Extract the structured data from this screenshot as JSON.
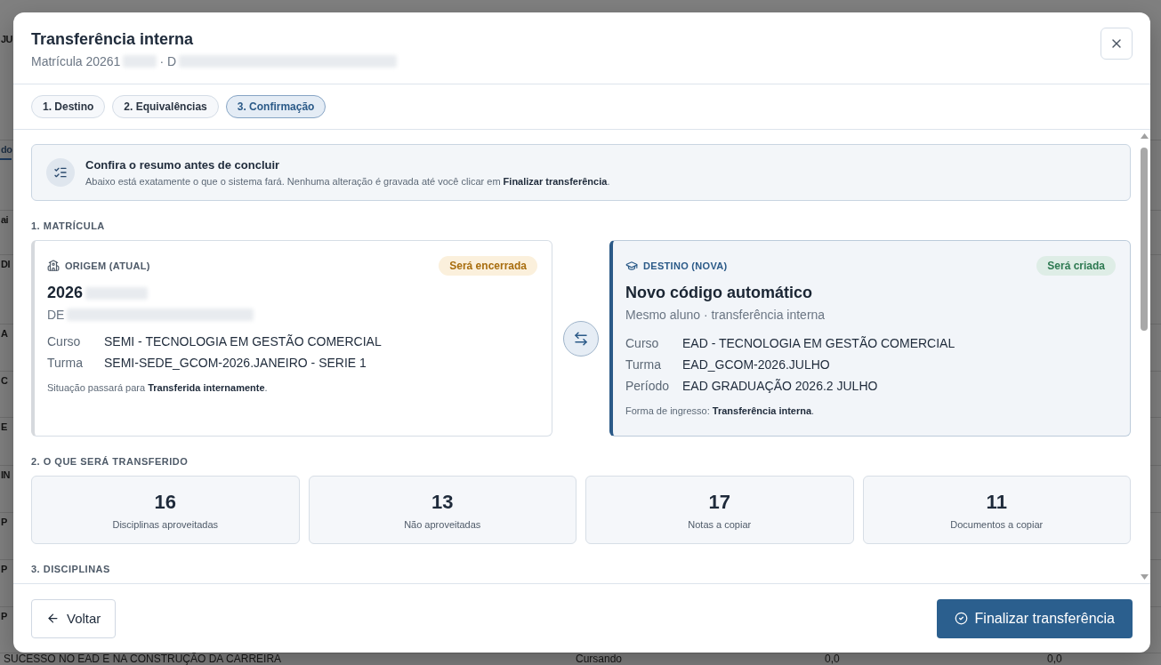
{
  "background": {
    "rows": [
      {
        "text": "JU"
      },
      {
        "text": "do",
        "selected": true
      },
      {
        "text": "ai"
      },
      {
        "text": "DI"
      },
      {
        "text": "A"
      },
      {
        "text": "C"
      },
      {
        "text": "E"
      },
      {
        "text": "IN"
      },
      {
        "text": "P"
      },
      {
        "text": "P"
      },
      {
        "text": "P"
      }
    ],
    "last_row": [
      "SUCESSO NO EAD E NA CONSTRUÇÃO DA CARREIRA",
      "Cursando",
      "0,0",
      "0,0"
    ]
  },
  "dialog": {
    "title": "Transferência interna",
    "subtitle": {
      "prefix": "Matrícula 20261",
      "separator": "· D",
      "redacted": true
    },
    "steps": [
      {
        "label": "1. Destino",
        "selected": false
      },
      {
        "label": "2. Equivalências",
        "selected": false
      },
      {
        "label": "3. Confirmação",
        "selected": true
      }
    ],
    "notice": {
      "title": "Confira o resumo antes de concluir",
      "text": "Abaixo está exatamente o que o sistema fará. Nenhuma alteração é gravada até você clicar em **Finalizar transferência**."
    },
    "enrollment": {
      "heading": "1. MATRÍCULA",
      "cards": [
        {
          "kind": "origin",
          "label": "ORIGEM (ATUAL)",
          "badge": "Será encerrada",
          "code": "2026",
          "subtitle": "DE",
          "redacted": true,
          "fields": [
            {
              "label": "Curso",
              "value": "SEMI - TECNOLOGIA EM GESTÃO COMERCIAL"
            },
            {
              "label": "Turma",
              "value": "SEMI-SEDE_GCOM-2026.JANEIRO - SERIE 1"
            }
          ],
          "note": "Situação passará para **Transferida internamente**."
        },
        {
          "kind": "destination",
          "label": "DESTINO (NOVA)",
          "badge": "Será criada",
          "code": "Novo código automático",
          "subtitle": "Mesmo aluno · transferência interna",
          "fields": [
            {
              "label": "Curso",
              "value": "EAD - TECNOLOGIA EM GESTÃO COMERCIAL"
            },
            {
              "label": "Turma",
              "value": "EAD_GCOM-2026.JULHO"
            },
            {
              "label": "Período",
              "value": "EAD GRADUAÇÃO 2026.2 JULHO"
            }
          ],
          "note": "Forma de ingresso: **Transferência interna**."
        }
      ]
    },
    "transfer": {
      "heading": "2. O QUE SERÁ TRANSFERIDO",
      "stats": [
        {
          "value": "16",
          "label": "Disciplinas aproveitadas"
        },
        {
          "value": "13",
          "label": "Não aproveitadas"
        },
        {
          "value": "17",
          "label": "Notas a copiar"
        },
        {
          "value": "11",
          "label": "Documentos a copiar"
        }
      ]
    },
    "disciplines": {
      "heading": "3. DISCIPLINAS"
    },
    "footer": {
      "back": "Voltar",
      "finish": "Finalizar transferência"
    }
  }
}
